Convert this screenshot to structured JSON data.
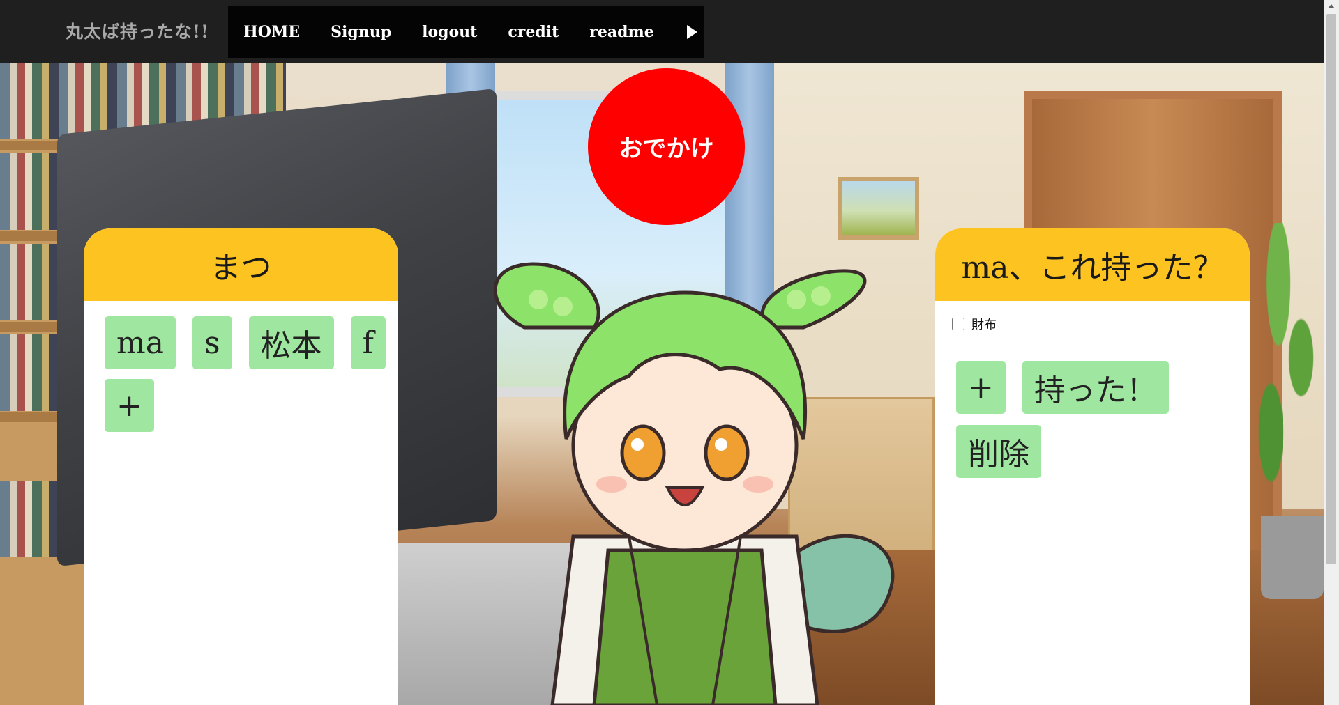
{
  "navbar": {
    "brand": "丸太ば持ったな!!",
    "items": [
      {
        "label": "HOME"
      },
      {
        "label": "Signup"
      },
      {
        "label": "logout"
      },
      {
        "label": "credit"
      },
      {
        "label": "readme"
      }
    ],
    "play_icon": "play-icon"
  },
  "go_button": {
    "label": "おでかけ",
    "color": "#ff0000"
  },
  "left_panel": {
    "title": "まつ",
    "chips": [
      "ma",
      "s",
      "松本",
      "f",
      "+"
    ]
  },
  "right_panel": {
    "title": "ma、これ持った？",
    "items": [
      {
        "label": "財布",
        "checked": false
      }
    ],
    "buttons": {
      "add": "+",
      "done": "持った！",
      "delete": "削除"
    }
  },
  "colors": {
    "navbar_bg": "#1f1f1f",
    "nav_box_bg": "#040404",
    "panel_header": "#fdc421",
    "chip_bg": "#9fe7a0",
    "brand_text": "#a9a9a9"
  }
}
